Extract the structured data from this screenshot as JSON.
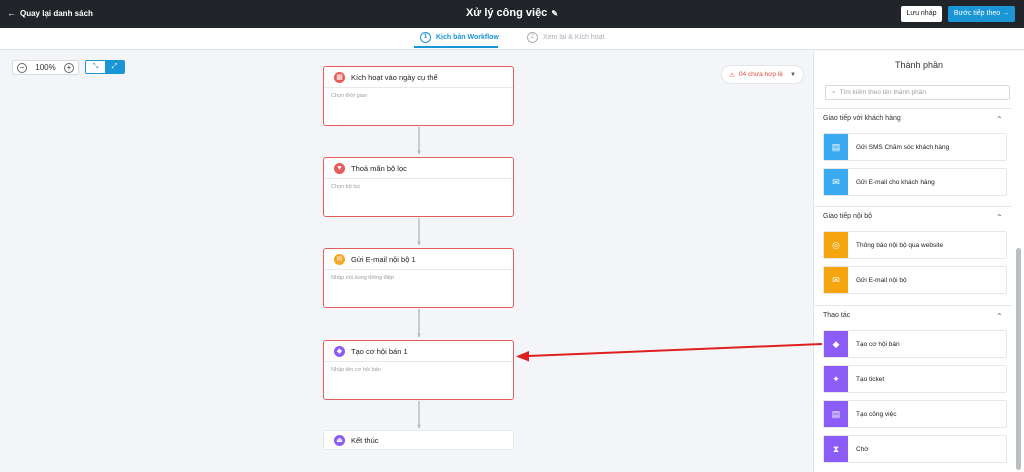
{
  "topbar": {
    "back_label": "Quay lại danh sách",
    "title": "Xử lý công việc",
    "save_label": "Lưu nháp",
    "next_label": "Bước tiếp theo"
  },
  "steps": [
    {
      "num": "1",
      "label": "Kịch bản Workflow"
    },
    {
      "num": "2",
      "label": "Xem lại & Kích hoạt"
    }
  ],
  "canvas": {
    "zoom_level": "100%",
    "warning": "04 chưa hợp lệ",
    "nodes": [
      {
        "title": "Kích hoạt vào ngày cụ thể",
        "subtitle": "Chọn thời gian",
        "icon": "calendar-icon",
        "color": "#e95a5a"
      },
      {
        "title": "Thoả mãn bộ lọc",
        "subtitle": "Chọn bộ lọc",
        "icon": "filter-icon",
        "color": "#e95a5a"
      },
      {
        "title": "Gửi E-mail nội bộ 1",
        "subtitle": "Nhập nội dung thông điệp",
        "icon": "mail-icon",
        "color": "#f5a623"
      },
      {
        "title": "Tạo cơ hội bán 1",
        "subtitle": "Nhập tên cơ hội bán",
        "icon": "opportunity-icon",
        "color": "#8b5cf6"
      }
    ],
    "end_node": {
      "title": "Kết thúc",
      "icon": "exit-icon",
      "color": "#8b5cf6"
    }
  },
  "panel": {
    "title": "Thành phần",
    "search_placeholder": "Tìm kiếm theo tên thành phần",
    "sections": [
      {
        "title": "Giao tiếp với khách hàng",
        "items": [
          {
            "label": "Gửi SMS Chăm sóc khách hàng",
            "icon": "sms-icon",
            "color": "#3aabf0"
          },
          {
            "label": "Gửi E-mail cho khách hàng",
            "icon": "mail-icon",
            "color": "#3aabf0"
          }
        ]
      },
      {
        "title": "Giao tiếp nội bộ",
        "items": [
          {
            "label": "Thông báo nội bộ qua website",
            "icon": "globe-icon",
            "color": "#f5a60f"
          },
          {
            "label": "Gửi E-mail nội bộ",
            "icon": "mail-icon",
            "color": "#f5a60f"
          }
        ]
      },
      {
        "title": "Thao tác",
        "items": [
          {
            "label": "Tạo cơ hội bán",
            "icon": "opportunity-icon",
            "color": "#8b5cf6"
          },
          {
            "label": "Tạo ticket",
            "icon": "ticket-icon",
            "color": "#8b5cf6"
          },
          {
            "label": "Tạo công việc",
            "icon": "task-icon",
            "color": "#8b5cf6"
          },
          {
            "label": "Chờ",
            "icon": "hourglass-icon",
            "color": "#8b5cf6"
          }
        ]
      }
    ]
  },
  "annotation_arrow_color": "#e02020"
}
